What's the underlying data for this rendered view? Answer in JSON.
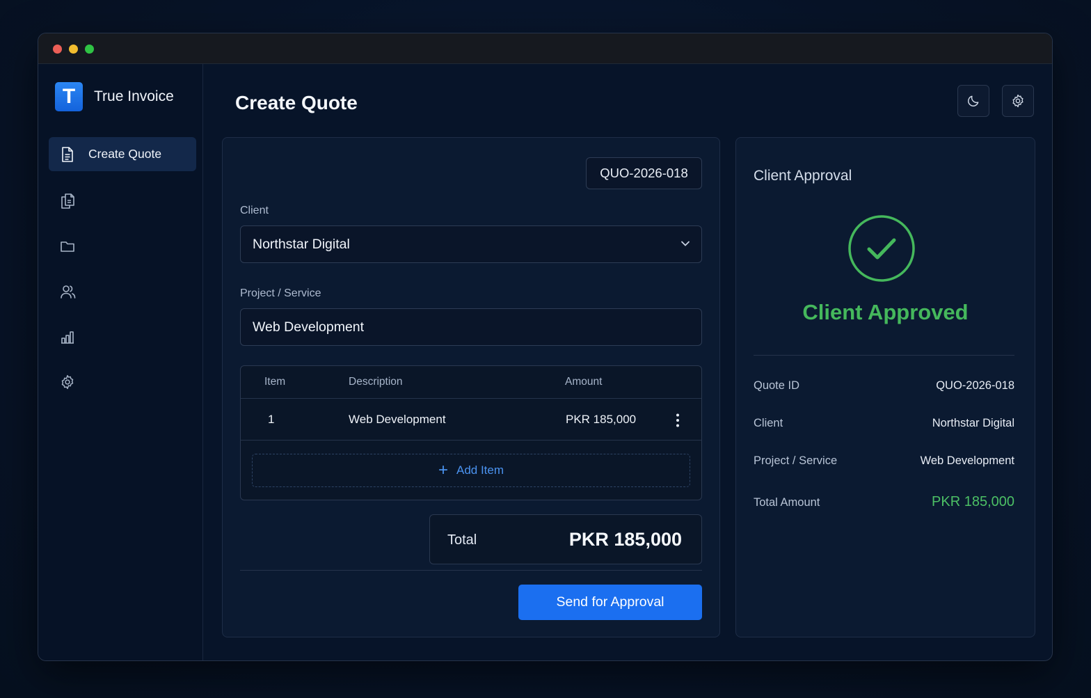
{
  "app": {
    "name": "True Invoice",
    "logo_letter": "T"
  },
  "sidebar": {
    "items": [
      {
        "label": "Create Quote",
        "icon": "document-icon",
        "active": true
      },
      {
        "label": "",
        "icon": "copy-documents-icon"
      },
      {
        "label": "",
        "icon": "folder-icon"
      },
      {
        "label": "",
        "icon": "users-icon"
      },
      {
        "label": "",
        "icon": "chart-icon"
      },
      {
        "label": "",
        "icon": "gear-icon"
      }
    ]
  },
  "header": {
    "title": "Create Quote",
    "actions": [
      {
        "icon": "moon-icon"
      },
      {
        "icon": "gear-icon"
      }
    ]
  },
  "form": {
    "quote_id": "QUO-2026-018",
    "client_label": "Client",
    "client_value": "Northstar Digital",
    "project_label": "Project / Service",
    "project_value": "Web Development",
    "table": {
      "headers": [
        "Item",
        "Description",
        "Amount"
      ],
      "rows": [
        {
          "item": "1",
          "description": "Web Development",
          "amount": "PKR 185,000"
        }
      ],
      "add_label": "Add Item"
    },
    "total_label": "Total",
    "total_value": "PKR 185,000",
    "submit_label": "Send for Approval"
  },
  "approval": {
    "title": "Client Approval",
    "status": "Client Approved",
    "summary": [
      {
        "key": "Quote ID",
        "value": "QUO-2026-018"
      },
      {
        "key": "Client",
        "value": "Northstar Digital"
      },
      {
        "key": "Project / Service",
        "value": "Web Development"
      },
      {
        "key": "Total Amount",
        "value": "PKR 185,000"
      }
    ]
  },
  "colors": {
    "accent": "#1b6ff0",
    "success": "#45b85c",
    "background": "#071327"
  }
}
